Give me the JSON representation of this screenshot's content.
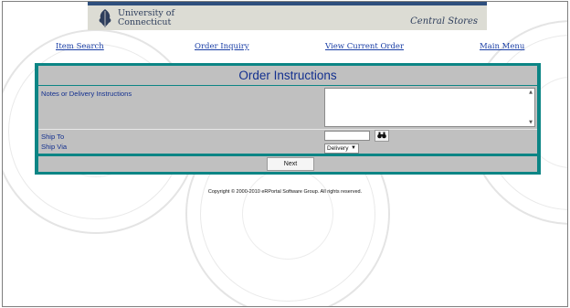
{
  "header": {
    "university_line1": "University of",
    "university_line2": "Connecticut",
    "store_title": "Central Stores",
    "logo_icon": "oak-leaf-logo-icon"
  },
  "nav": {
    "item_search": "Item Search",
    "order_inquiry": "Order Inquiry",
    "view_current_order": "View Current Order",
    "main_menu": "Main Menu"
  },
  "form": {
    "title": "Order Instructions",
    "notes_label": "Notes or Delivery Instructions",
    "notes_value": "",
    "ship_to_label": "Ship To",
    "ship_to_value": "",
    "ship_to_search_icon": "binoculars-icon",
    "ship_via_label": "Ship Via",
    "ship_via_selected": "Delivery",
    "next_label": "Next"
  },
  "footer": {
    "copyright": "Copyright © 2000-2010 eRPortal Software Group.   All rights reserved."
  },
  "colors": {
    "panel_teal": "#0c8585",
    "panel_gray": "#c0c0c0",
    "title_blue": "#13308f",
    "link_blue": "#1b3fa6",
    "banner_stripe": "#2e4f7d"
  }
}
